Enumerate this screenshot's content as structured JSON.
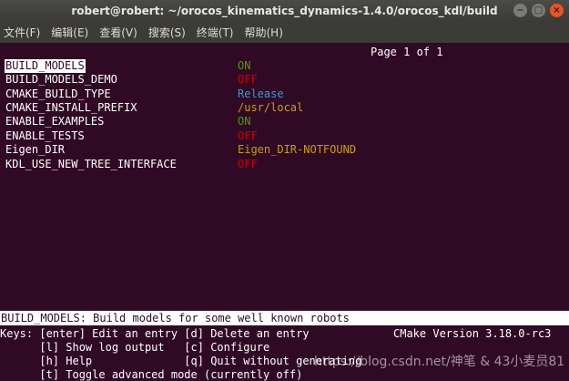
{
  "window": {
    "title": "robert@robert: ~/orocos_kinematics_dynamics-1.4.0/orocos_kdl/build",
    "buttons": [
      "−",
      "□",
      "×"
    ]
  },
  "menu": [
    "文件(F)",
    "编辑(E)",
    "查看(V)",
    "搜索(S)",
    "终端(T)",
    "帮助(H)"
  ],
  "pager": "Page 1 of 1",
  "entries": [
    {
      "key": "BUILD_MODELS",
      "value": "ON",
      "kind": "on"
    },
    {
      "key": "BUILD_MODELS_DEMO",
      "value": "OFF",
      "kind": "off"
    },
    {
      "key": "CMAKE_BUILD_TYPE",
      "value": "Release",
      "kind": "str"
    },
    {
      "key": "CMAKE_INSTALL_PREFIX",
      "value": "/usr/local",
      "kind": "path"
    },
    {
      "key": "ENABLE_EXAMPLES",
      "value": "ON",
      "kind": "on"
    },
    {
      "key": "ENABLE_TESTS",
      "value": "OFF",
      "kind": "off"
    },
    {
      "key": "Eigen_DIR",
      "value": "Eigen_DIR-NOTFOUND",
      "kind": "path"
    },
    {
      "key": "KDL_USE_NEW_TREE_INTERFACE",
      "value": "OFF",
      "kind": "off"
    }
  ],
  "status": "BUILD_MODELS: Build models for some well known robots",
  "help_lines": [
    "Keys: [enter] Edit an entry [d] Delete an entry",
    "      [l] Show log output   [c] Configure",
    "      [h] Help              [q] Quit without generating",
    "      [t] Toggle advanced mode (currently off)"
  ],
  "cmake_version": "CMake Version 3.18.0-rc3",
  "watermark": "https://blog.csdn.net/神笔 & 43小麦员81"
}
